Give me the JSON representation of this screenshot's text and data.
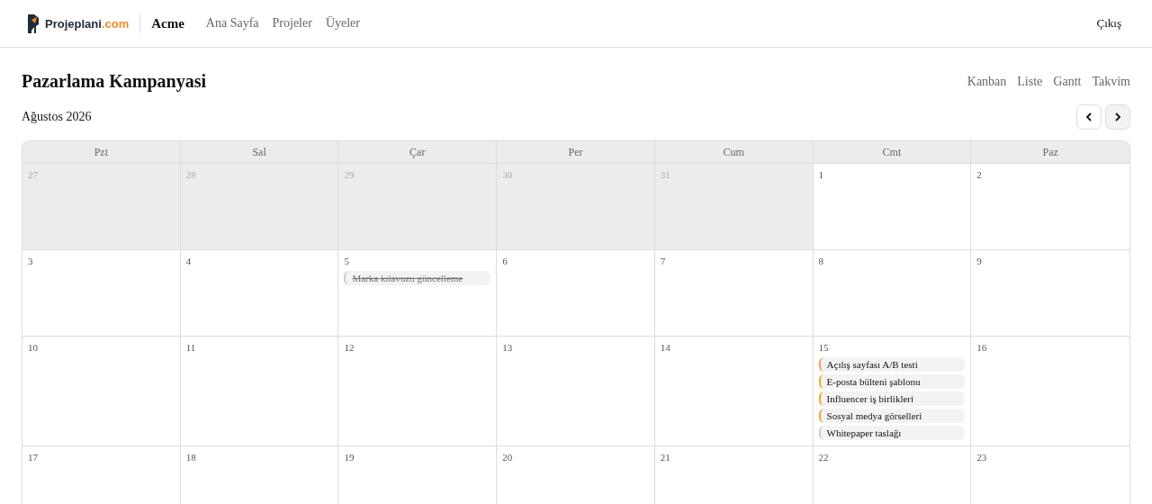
{
  "header": {
    "logo": {
      "name": "Projeplani",
      "tld": ".com"
    },
    "workspace": "Acme",
    "nav": [
      "Ana Sayfa",
      "Projeler",
      "Üyeler"
    ],
    "logout": "Çıkış"
  },
  "project": {
    "title": "Pazarlama Kampanyasi",
    "views": [
      "Kanban",
      "Liste",
      "Gantt",
      "Takvim"
    ]
  },
  "month": "Ağustos 2026",
  "weekdays": [
    "Pzt",
    "Sal",
    "Çar",
    "Per",
    "Cum",
    "Cmt",
    "Paz"
  ],
  "weeks": [
    [
      {
        "day": "27",
        "outside": true
      },
      {
        "day": "28",
        "outside": true
      },
      {
        "day": "29",
        "outside": true
      },
      {
        "day": "30",
        "outside": true
      },
      {
        "day": "31",
        "outside": true
      },
      {
        "day": "1",
        "outside": false
      },
      {
        "day": "2",
        "outside": false
      }
    ],
    [
      {
        "day": "3",
        "outside": false
      },
      {
        "day": "4",
        "outside": false
      },
      {
        "day": "5",
        "outside": false,
        "events": [
          {
            "title": "Marka kılavuzu güncelleme",
            "done": true,
            "color": "#cccccc"
          }
        ]
      },
      {
        "day": "6",
        "outside": false
      },
      {
        "day": "7",
        "outside": false
      },
      {
        "day": "8",
        "outside": false
      },
      {
        "day": "9",
        "outside": false
      }
    ],
    [
      {
        "day": "10",
        "outside": false
      },
      {
        "day": "11",
        "outside": false
      },
      {
        "day": "12",
        "outside": false
      },
      {
        "day": "13",
        "outside": false
      },
      {
        "day": "14",
        "outside": false
      },
      {
        "day": "15",
        "outside": false,
        "events": [
          {
            "title": "Açılış sayfası A/B testi",
            "done": false,
            "color": "#f0a050"
          },
          {
            "title": "E-posta bülteni şablonu",
            "done": false,
            "color": "#f5a623"
          },
          {
            "title": "Influencer iş birlikleri",
            "done": false,
            "color": "#f5a623"
          },
          {
            "title": "Sosyal medya görselleri",
            "done": false,
            "color": "#f5a623"
          },
          {
            "title": "Whitepaper taslağı",
            "done": false,
            "color": "#cccccc"
          }
        ]
      },
      {
        "day": "16",
        "outside": false
      }
    ],
    [
      {
        "day": "17",
        "outside": false
      },
      {
        "day": "18",
        "outside": false
      },
      {
        "day": "19",
        "outside": false
      },
      {
        "day": "20",
        "outside": false
      },
      {
        "day": "21",
        "outside": false
      },
      {
        "day": "22",
        "outside": false
      },
      {
        "day": "23",
        "outside": false
      }
    ]
  ]
}
